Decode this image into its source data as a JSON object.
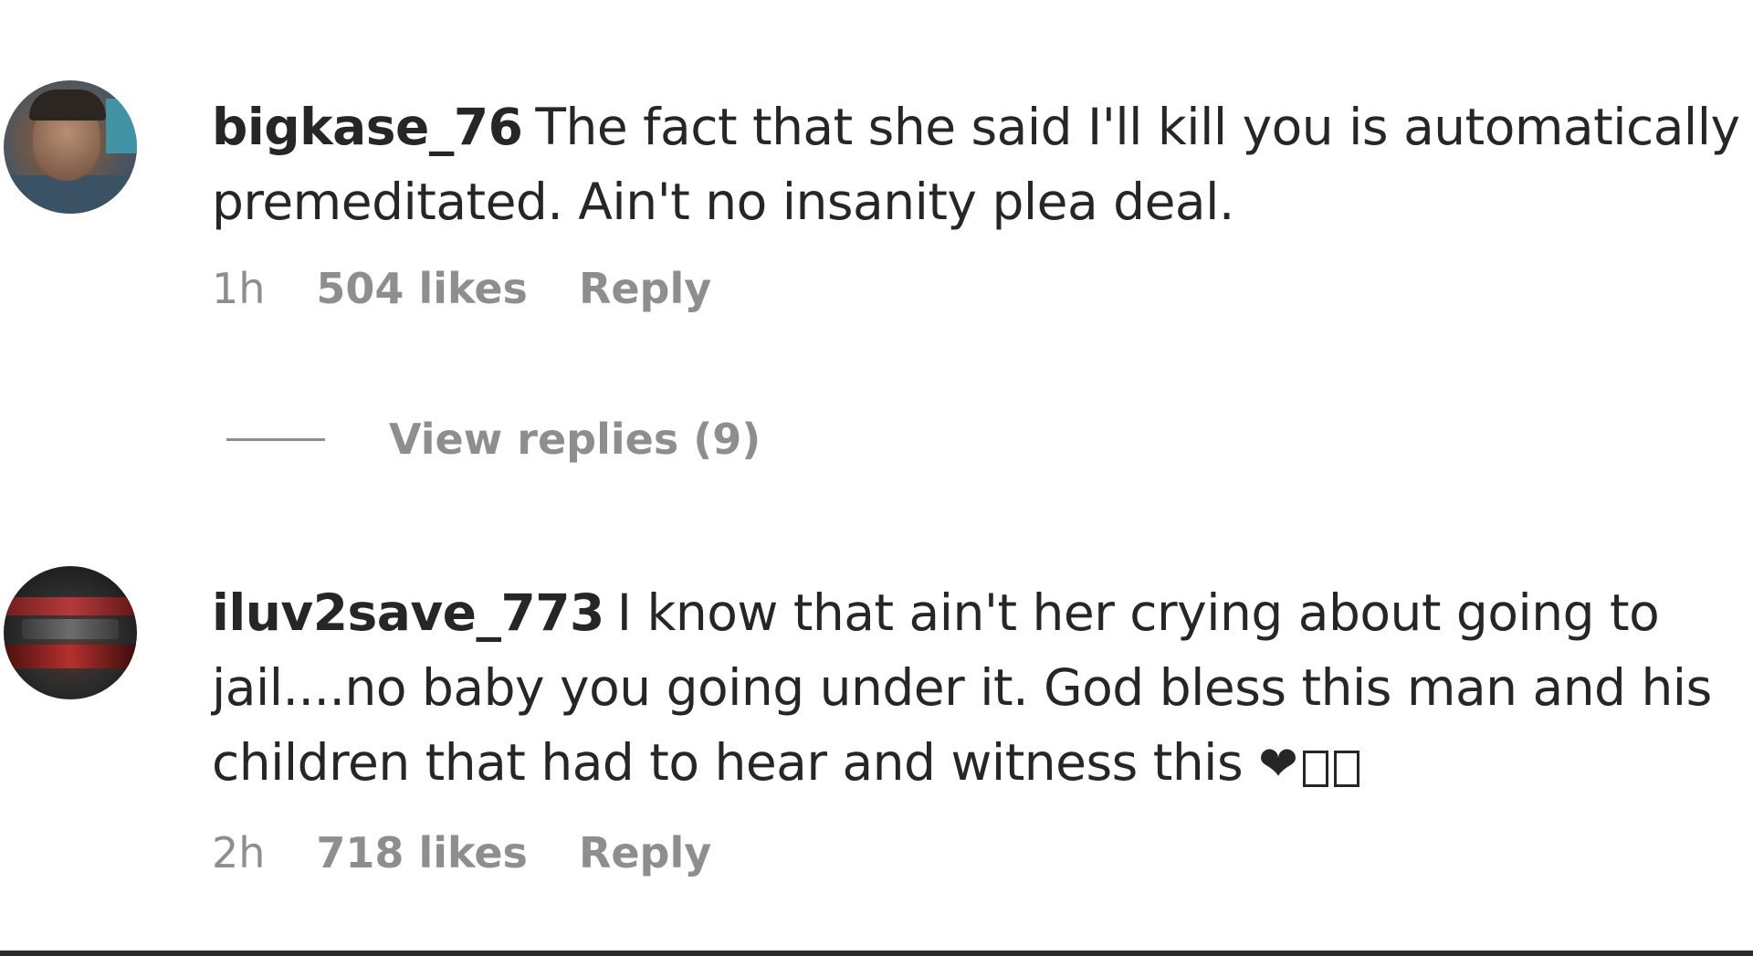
{
  "comments": [
    {
      "username": "bigkase_76",
      "text": "The fact that she said I'll kill you is automatically premeditated. Ain't no insanity plea deal.",
      "time": "1h",
      "likes": "504 likes",
      "reply_label": "Reply",
      "avatar_icon": "user-avatar-photo"
    },
    {
      "username": "iluv2save_773",
      "text": "I know that ain't her crying about going to jail....no baby you going under it. God bless this man and his children that had to hear and witness this",
      "emoji": "❤",
      "time": "2h",
      "likes": "718 likes",
      "reply_label": "Reply",
      "avatar_icon": "user-avatar-photo"
    }
  ],
  "view_replies": {
    "label": "View replies (9)"
  },
  "colors": {
    "text": "#262626",
    "muted": "#8e8e8e",
    "background": "#ffffff"
  }
}
